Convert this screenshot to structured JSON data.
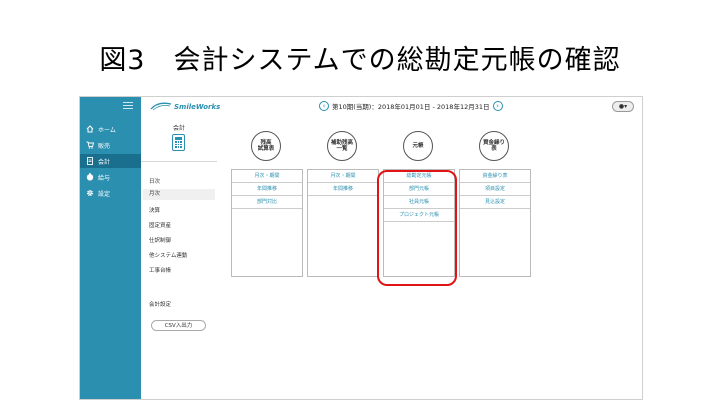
{
  "slide_title": "図3　会計システムでの総勘定元帳の確認",
  "app": {
    "logo_text": "SmileWorks",
    "period_text": "第10期(当期)：2018年01月01日 - 2018年12月31日",
    "prev_icon": "chevron-left-circle-icon",
    "next_icon": "chevron-right-circle-icon",
    "user_icon": "user-dropdown-icon"
  },
  "sidebar": {
    "items": [
      {
        "label": "ホーム",
        "icon": "home-icon"
      },
      {
        "label": "販売",
        "icon": "cart-icon"
      },
      {
        "label": "会計",
        "icon": "document-icon"
      },
      {
        "label": "給与",
        "icon": "coin-icon"
      },
      {
        "label": "設定",
        "icon": "gear-icon"
      }
    ]
  },
  "subnav": {
    "heading": "会計",
    "items": [
      "日次",
      "月次",
      "決算",
      "固定資産",
      "仕訳制御",
      "他システム連動",
      "工事台帳"
    ],
    "settings": "会計設定",
    "csv_button": "CSV入出力"
  },
  "columns": [
    {
      "title": "残高\n試算表",
      "items": [
        "月次・期間",
        "年間推移",
        "部門対比"
      ]
    },
    {
      "title": "補助残高\n一覧",
      "items": [
        "月次・期間",
        "年間推移"
      ]
    },
    {
      "title": "元帳",
      "items": [
        "総勘定元帳",
        "部門元帳",
        "社員元帳",
        "プロジェクト元帳"
      ]
    },
    {
      "title": "資金繰り\n表",
      "items": [
        "資金繰り表",
        "項目設定",
        "見込設定"
      ]
    }
  ],
  "colors": {
    "accent": "#2b8fb0",
    "sidebar_bg": "#2b8fb0",
    "sidebar_active": "#1b6f8e",
    "highlight": "#e01414"
  }
}
